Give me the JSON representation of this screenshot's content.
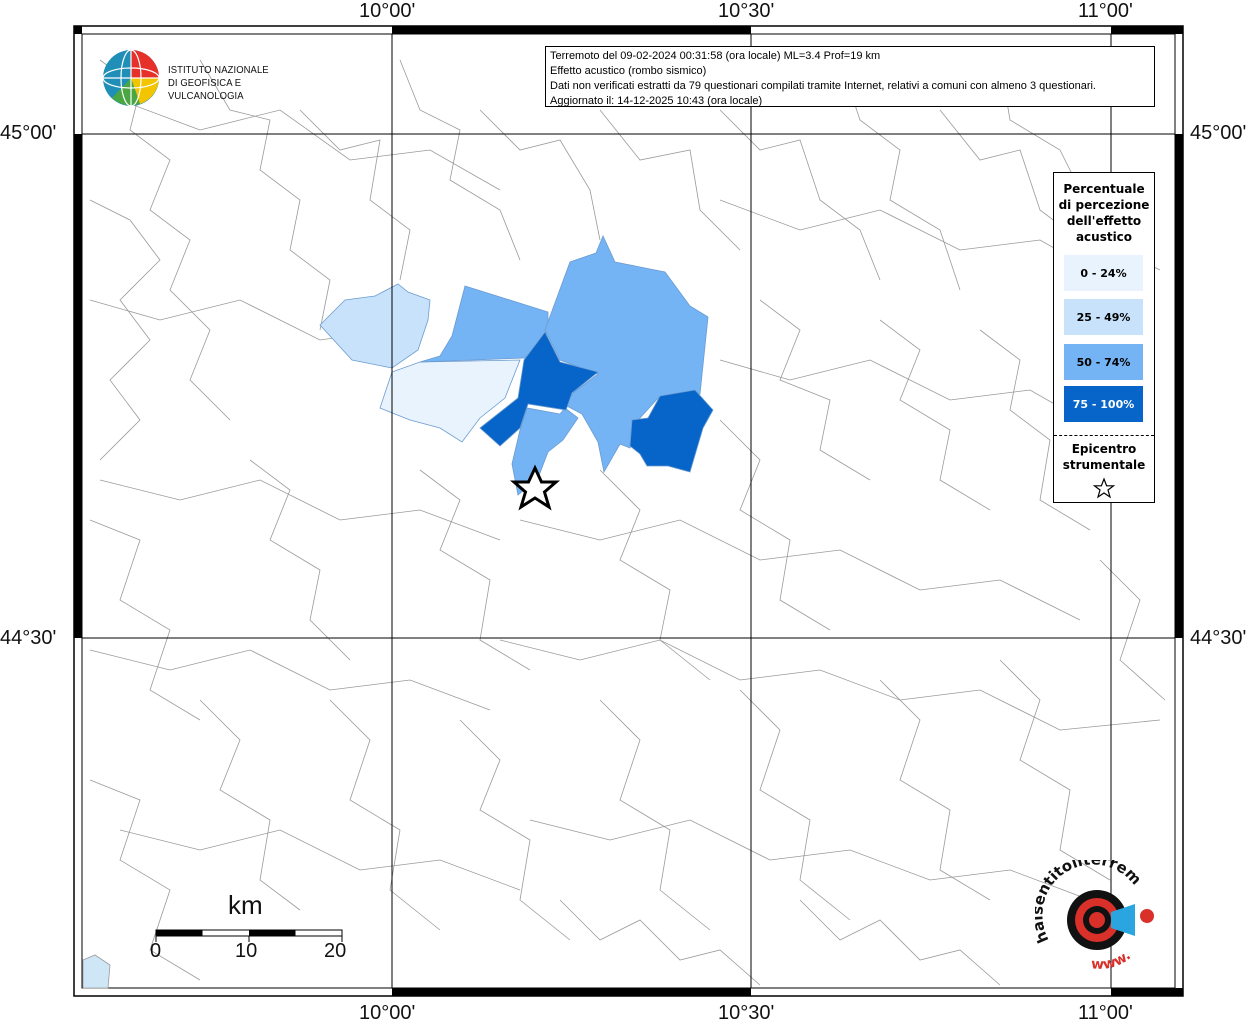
{
  "lon_labels": [
    "10°00'",
    "10°30'",
    "11°00'"
  ],
  "lat_labels": [
    "45°00'",
    "44°30'"
  ],
  "info_lines": [
    "Terremoto del 09-02-2024 00:31:58 (ora locale) ML=3.4 Prof=19 km",
    "Effetto acustico (rombo sismico)",
    "Dati non verificati estratti da 79 questionari compilati tramite Internet, relativi a comuni con almeno 3 questionari.",
    "Aggiornato il: 14-12-2025 10:43 (ora locale)"
  ],
  "ingv": {
    "line1": "ISTITUTO NAZIONALE",
    "line2": "DI GEOFISICA E VULCANOLOGIA"
  },
  "legend": {
    "title_lines": [
      "Percentuale",
      "di percezione",
      "dell'effetto",
      "acustico"
    ],
    "classes": [
      {
        "label": "0 - 24%",
        "color": "#e8f3fd",
        "text": "#000000"
      },
      {
        "label": "25 - 49%",
        "color": "#c8e2fb",
        "text": "#000000"
      },
      {
        "label": "50 - 74%",
        "color": "#74b4f5",
        "text": "#000000"
      },
      {
        "label": "75 - 100%",
        "color": "#0764c8",
        "text": "#ffffff"
      }
    ],
    "epicenter_lines": [
      "Epicentro",
      "strumentale"
    ]
  },
  "scalebar": {
    "unit": "km",
    "ticks": [
      "0",
      "10",
      "20"
    ]
  },
  "hsn_logo": {
    "text": "haisentitoilterremoto.it",
    "www": "www."
  },
  "colors": {
    "grid": "#000000",
    "borders": "#9a9a9a",
    "sea": "#cfe6f7"
  }
}
